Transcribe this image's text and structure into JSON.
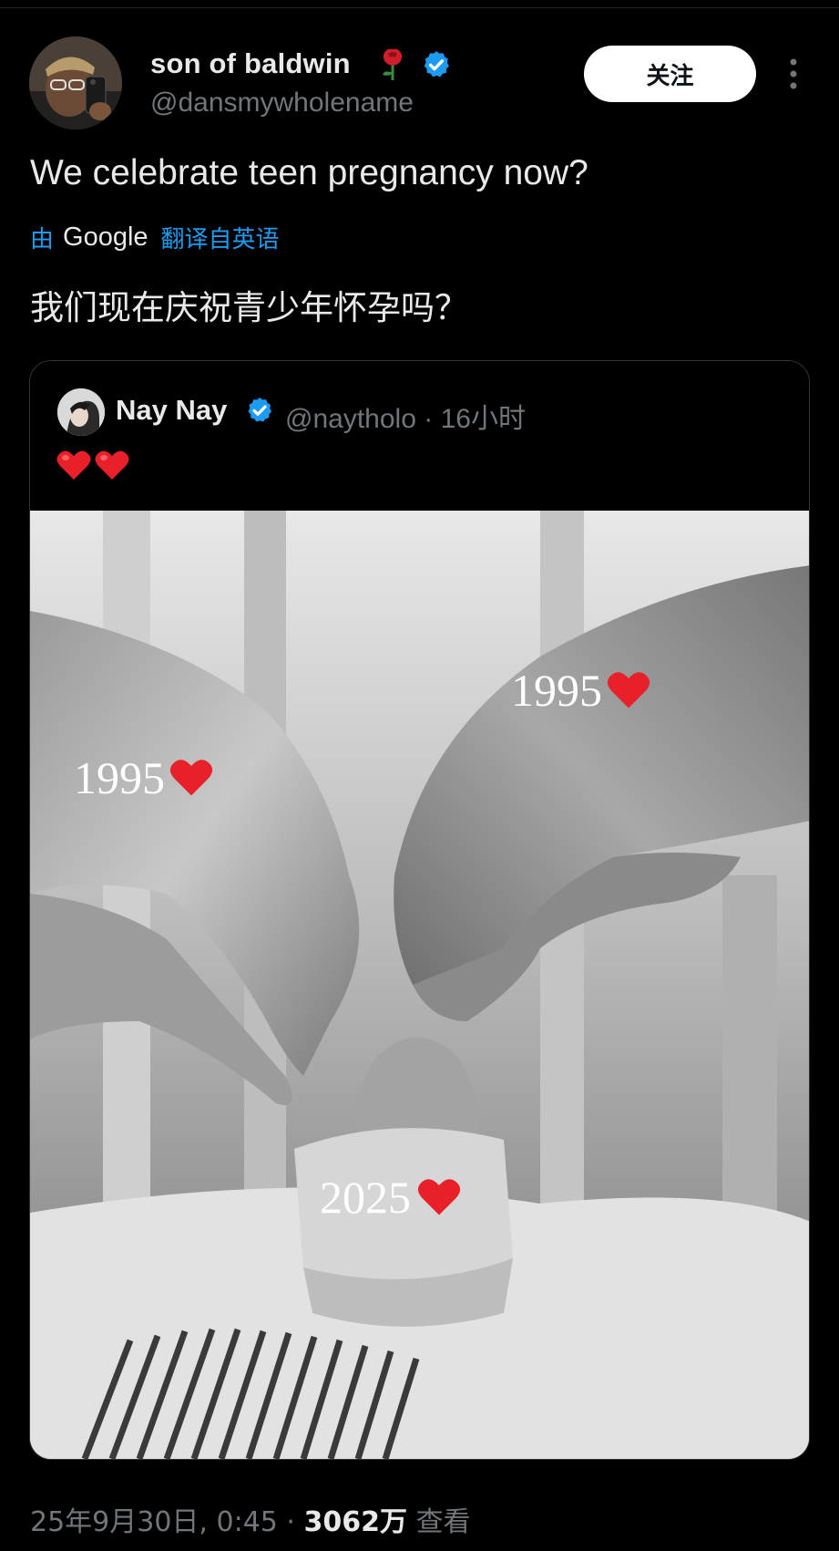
{
  "author": {
    "display_name": "son of baldwin",
    "handle": "@dansmywholename",
    "verified_color": "#1d9bf0"
  },
  "follow_button": {
    "label": "关注"
  },
  "tweet": {
    "text": "We celebrate teen pregnancy now?",
    "translation": {
      "by_label": "由",
      "provider": "Google",
      "link_label": "翻译自英语",
      "text": "我们现在庆祝青少年怀孕吗？"
    }
  },
  "quoted": {
    "display_name": "Nay Nay",
    "handle": "@naytholo",
    "separator": "·",
    "time": "16小时",
    "body_hearts": 2,
    "photo_labels": {
      "left_hand": "1995",
      "right_hand": "1995",
      "baby": "2025"
    }
  },
  "footer": {
    "date": "25年9月30日, 0:45",
    "separator": "·",
    "views": "3062万",
    "views_label": "查看"
  },
  "icons": [
    "rose-icon",
    "verified-icon",
    "more-icon",
    "heart-icon"
  ],
  "colors": {
    "accent": "#1d9bf0",
    "background": "#000000",
    "muted": "#71767b",
    "heart": "#e8202a"
  }
}
